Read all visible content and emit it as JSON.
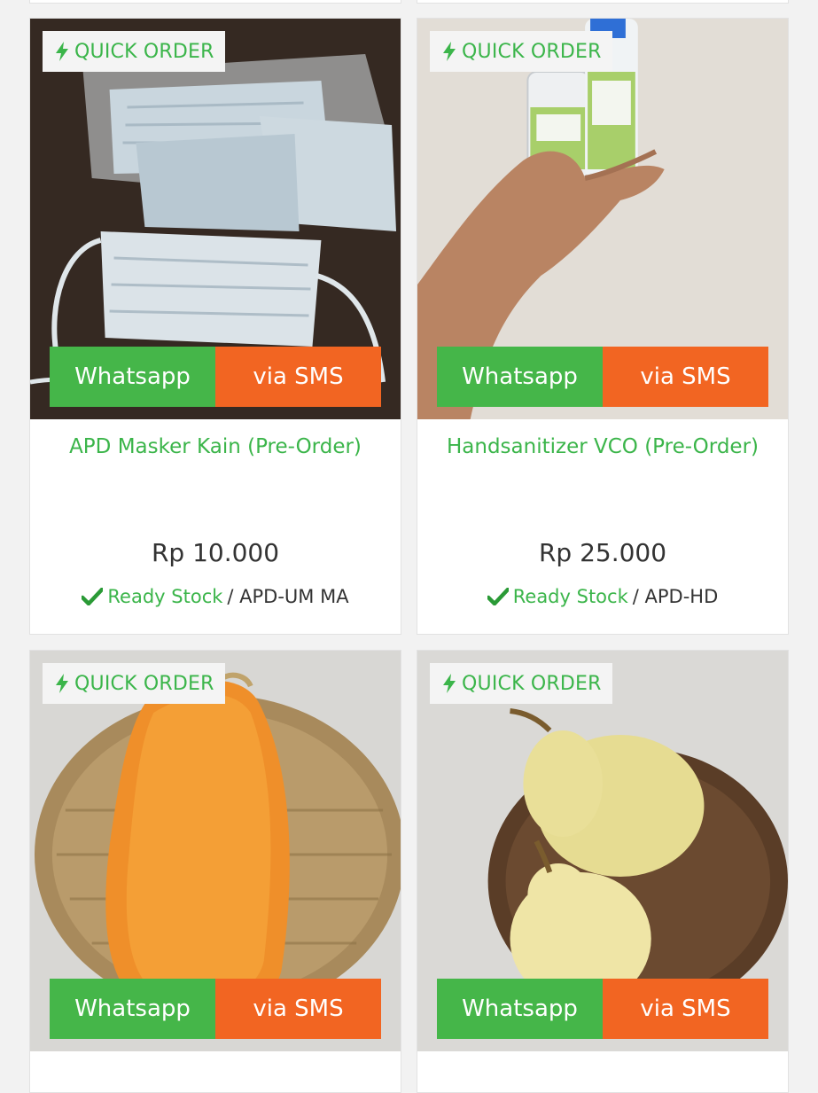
{
  "badge_label": "QUICK ORDER",
  "icons": {
    "badge": "lightning-bolt-icon",
    "stock": "checkmark-icon"
  },
  "colors": {
    "brand_green": "#3bb54a",
    "whatsapp": "#45b649",
    "sms": "#f26522",
    "price_text": "#333333"
  },
  "products": [
    {
      "title": "APD Masker Kain (Pre-Order)",
      "price": "Rp 10.000",
      "stock_label": "Ready Stock",
      "sku": " / APD-UM MA",
      "whatsapp_label": "Whatsapp",
      "sms_label": "via SMS"
    },
    {
      "title": "Handsanitizer VCO (Pre-Order)",
      "price": "Rp 25.000",
      "stock_label": "Ready Stock",
      "sku": " / APD-HD",
      "whatsapp_label": "Whatsapp",
      "sms_label": "via SMS"
    },
    {
      "whatsapp_label": "Whatsapp",
      "sms_label": "via SMS"
    },
    {
      "whatsapp_label": "Whatsapp",
      "sms_label": "via SMS"
    }
  ]
}
